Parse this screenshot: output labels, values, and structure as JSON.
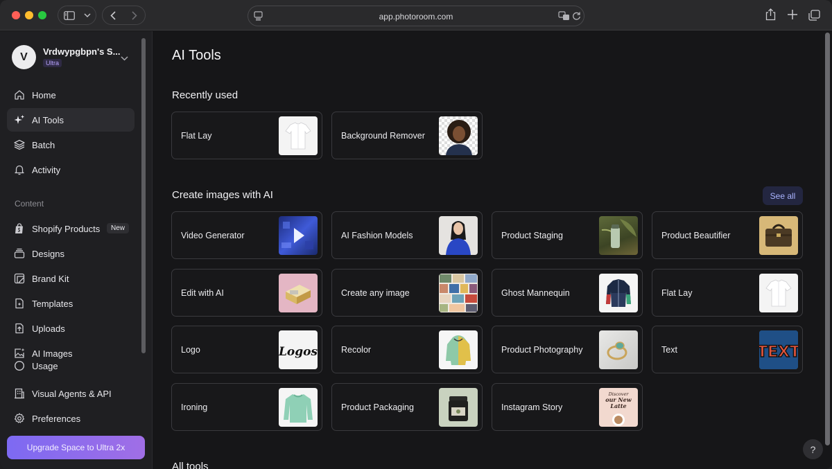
{
  "browser": {
    "url": "app.photoroom.com"
  },
  "sidebar": {
    "workspace": {
      "initial": "V",
      "name": "Vrdwypgbpn's S...",
      "plan_badge": "Ultra"
    },
    "items": [
      {
        "label": "Home",
        "icon": "home-icon"
      },
      {
        "label": "AI Tools",
        "icon": "sparkles-icon"
      },
      {
        "label": "Batch",
        "icon": "layers-icon"
      },
      {
        "label": "Activity",
        "icon": "bell-icon"
      }
    ],
    "section_label": "Content",
    "content_items": [
      {
        "label": "Shopify Products",
        "icon": "shopify-bag-icon",
        "badge": "New"
      },
      {
        "label": "Designs",
        "icon": "stack-icon"
      },
      {
        "label": "Brand Kit",
        "icon": "brand-kit-icon"
      },
      {
        "label": "Templates",
        "icon": "template-icon"
      },
      {
        "label": "Uploads",
        "icon": "upload-icon"
      },
      {
        "label": "AI Images",
        "icon": "ai-image-icon"
      },
      {
        "label": "Usage",
        "icon": "usage-ring-icon"
      },
      {
        "label": "Visual Agents & API",
        "icon": "building-icon"
      },
      {
        "label": "Preferences",
        "icon": "gear-icon"
      }
    ],
    "upgrade_label": "Upgrade Space to Ultra 2x"
  },
  "main": {
    "title": "AI Tools",
    "recently_used": {
      "title": "Recently used",
      "cards": [
        {
          "label": "Flat Lay",
          "thumb": "white-shirt"
        },
        {
          "label": "Background Remover",
          "thumb": "portrait-cutout"
        }
      ]
    },
    "create": {
      "title": "Create images with AI",
      "see_all": "See all",
      "cards": [
        {
          "label": "Video Generator",
          "thumb": "video-play"
        },
        {
          "label": "AI Fashion Models",
          "thumb": "fashion-model"
        },
        {
          "label": "Product Staging",
          "thumb": "bottle-staging"
        },
        {
          "label": "Product Beautifier",
          "thumb": "leather-bag"
        },
        {
          "label": "Edit with AI",
          "thumb": "gold-box"
        },
        {
          "label": "Create any image",
          "thumb": "image-grid"
        },
        {
          "label": "Ghost Mannequin",
          "thumb": "jacket"
        },
        {
          "label": "Flat Lay",
          "thumb": "white-shirt"
        },
        {
          "label": "Logo",
          "thumb": "logo-text"
        },
        {
          "label": "Recolor",
          "thumb": "hoodie"
        },
        {
          "label": "Product Photography",
          "thumb": "ring"
        },
        {
          "label": "Text",
          "thumb": "graffiti-text"
        },
        {
          "label": "Ironing",
          "thumb": "sweater"
        },
        {
          "label": "Product Packaging",
          "thumb": "jar"
        },
        {
          "label": "Instagram Story",
          "thumb": "story-poster"
        }
      ]
    },
    "all_tools_title": "All tools",
    "thumb_text": {
      "logo": "Logos",
      "graffiti": "TEXT",
      "story_line1": "Discover",
      "story_line2": "our New",
      "story_line3": "Latte"
    },
    "help_label": "?"
  },
  "colors": {
    "accent": "#8b6cf0",
    "see_all_bg": "#232640",
    "see_all_text": "#aab4ff"
  }
}
